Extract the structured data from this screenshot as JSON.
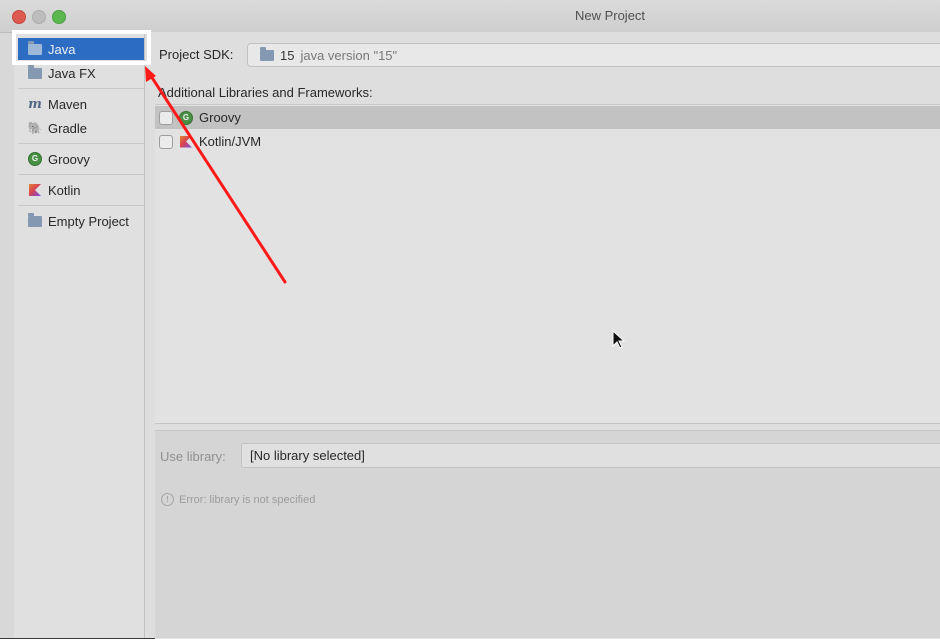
{
  "window": {
    "title": "New Project"
  },
  "sidebar": {
    "items": [
      {
        "label": "Java",
        "icon": "folder-icon"
      },
      {
        "label": "Java FX",
        "icon": "folder-icon"
      },
      {
        "label": "Maven",
        "icon": "maven-icon"
      },
      {
        "label": "Gradle",
        "icon": "gradle-icon"
      },
      {
        "label": "Groovy",
        "icon": "groovy-icon"
      },
      {
        "label": "Kotlin",
        "icon": "kotlin-icon"
      },
      {
        "label": "Empty Project",
        "icon": "folder-icon"
      }
    ],
    "selected": "Java"
  },
  "main": {
    "sdk_label": "Project SDK:",
    "sdk_value_number": "15",
    "sdk_value_version": "java version \"15\"",
    "libs_label": "Additional Libraries and Frameworks:",
    "libraries": [
      {
        "label": "Groovy",
        "checked": false,
        "icon": "groovy-icon"
      },
      {
        "label": "Kotlin/JVM",
        "checked": false,
        "icon": "kotlin-icon"
      }
    ],
    "use_library_label": "Use library:",
    "use_library_value": "[No library selected]",
    "error_text": "Error: library is not specified"
  },
  "colors": {
    "selection": "#2f74d0",
    "annotation_arrow": "#ff1a1a",
    "highlight_box": "#ffffff"
  }
}
